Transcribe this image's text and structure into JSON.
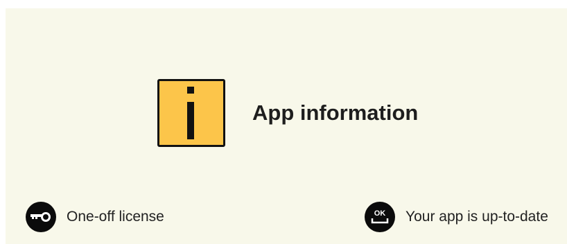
{
  "header": {
    "title": "App information",
    "icon": "info-icon"
  },
  "status": {
    "license": {
      "icon": "key-icon",
      "label": "One-off license"
    },
    "update": {
      "icon": "ok-badge-icon",
      "label": "Your app is up-to-date",
      "badge_text": "OK"
    }
  },
  "colors": {
    "panel_background": "#f8f8ea",
    "info_icon_fill": "#fcc54a",
    "icon_dark": "#0b0b0b",
    "text": "#1e1e1e"
  }
}
